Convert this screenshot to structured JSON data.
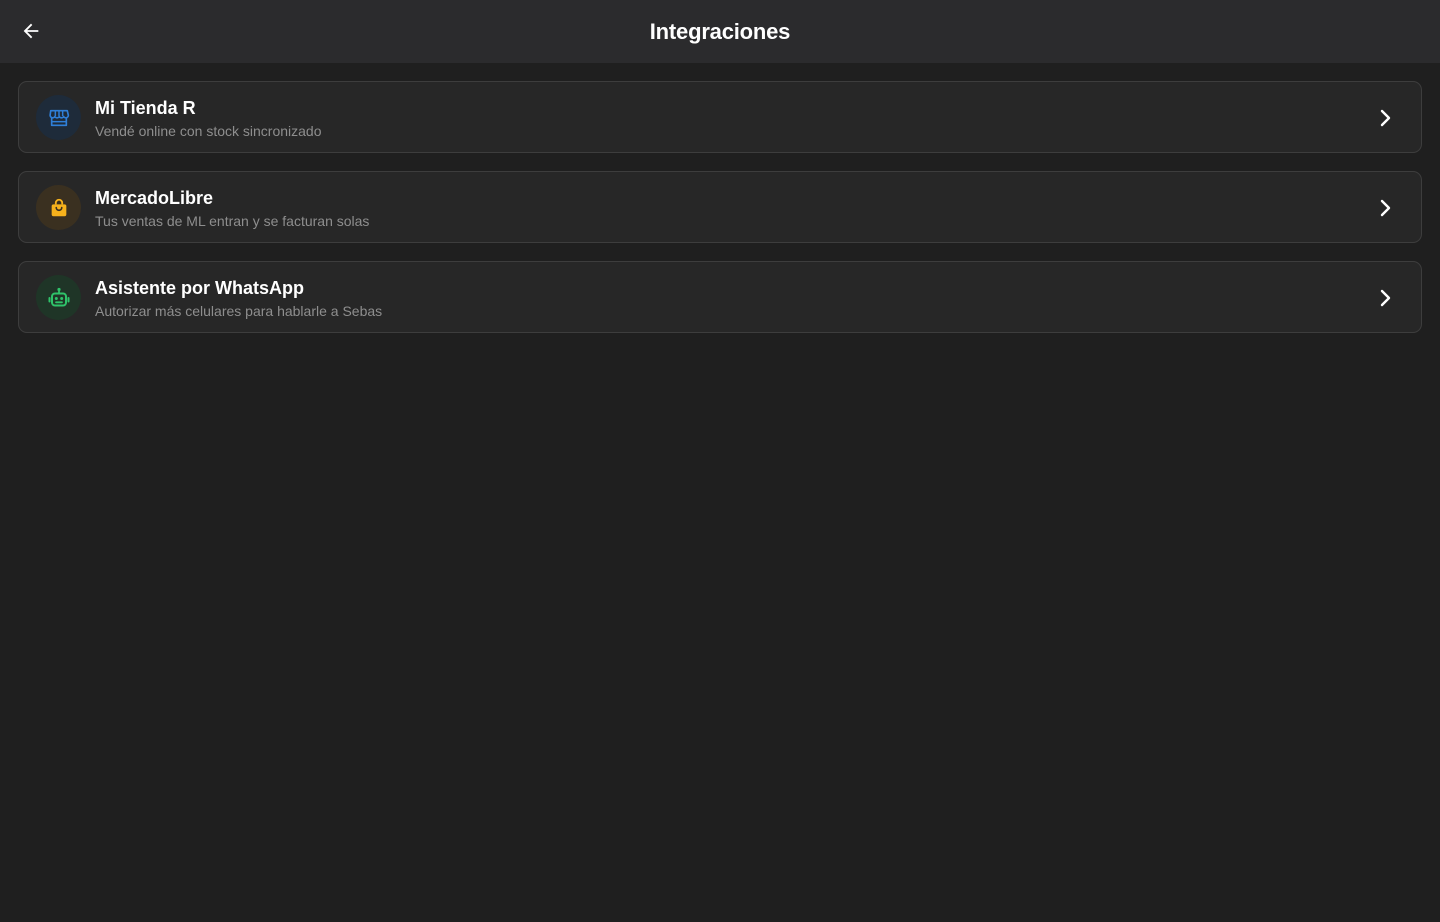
{
  "appbar": {
    "title": "Integraciones",
    "back_icon": "arrow-left-icon"
  },
  "integrations": [
    {
      "title": "Mi Tienda R",
      "subtitle": "Vendé online con stock sincronizado",
      "icon": "storefront-icon",
      "icon_color": "#2f7fd8",
      "icon_bg": "#1e2b3a"
    },
    {
      "title": "MercadoLibre",
      "subtitle": "Tus ventas de ML entran y se facturan solas",
      "icon": "shopping-bag-icon",
      "icon_color": "#f7b21c",
      "icon_bg": "#3a3020"
    },
    {
      "title": "Asistente por WhatsApp",
      "subtitle": "Autorizar más celulares para hablarle a Sebas",
      "icon": "robot-icon",
      "icon_color": "#2fc36a",
      "icon_bg": "#1f3527"
    }
  ],
  "colors": {
    "background": "#1f1f1f",
    "appbar": "#2b2b2d",
    "card": "#272727",
    "card_border": "#3d3d3d",
    "subtitle": "#8e8e8e"
  }
}
